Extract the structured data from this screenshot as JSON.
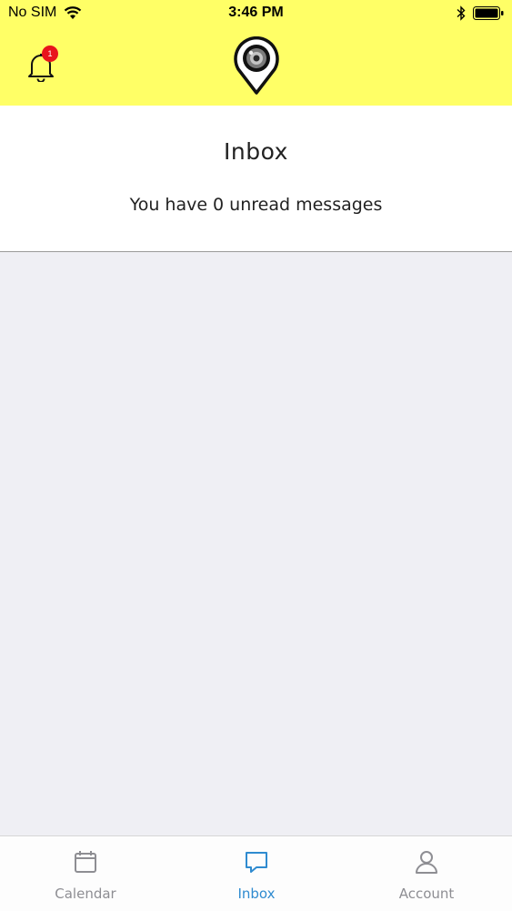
{
  "status_bar": {
    "carrier": "No SIM",
    "time": "3:46 PM"
  },
  "header": {
    "notification_count": "1"
  },
  "inbox": {
    "title": "Inbox",
    "subtitle": "You have 0 unread messages"
  },
  "tabs": [
    {
      "label": "Calendar",
      "icon": "calendar-icon",
      "active": false
    },
    {
      "label": "Inbox",
      "icon": "chat-bubble-icon",
      "active": true
    },
    {
      "label": "Account",
      "icon": "person-icon",
      "active": false
    }
  ],
  "colors": {
    "header_bg": "#ffff66",
    "badge": "#e8141c",
    "active_tab": "#2f8bd0",
    "inactive_tab": "#8e8e93",
    "list_bg": "#efeff4"
  }
}
